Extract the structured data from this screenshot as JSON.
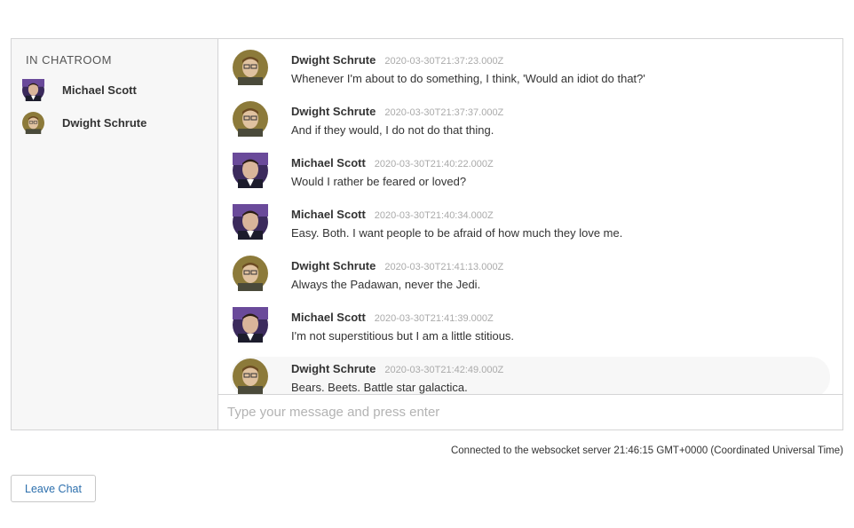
{
  "sidebar": {
    "heading": "IN CHATROOM",
    "members": [
      {
        "name": "Michael Scott",
        "avatar": "michael-avatar"
      },
      {
        "name": "Dwight Schrute",
        "avatar": "dwight-avatar"
      }
    ]
  },
  "messages": [
    {
      "author": "Dwight Schrute",
      "time": "2020-03-30T21:37:23.000Z",
      "text": "Whenever I'm about to do something, I think, 'Would an idiot do that?'"
    },
    {
      "author": "Dwight Schrute",
      "time": "2020-03-30T21:37:37.000Z",
      "text": "And if they would, I do not do that thing."
    },
    {
      "author": "Michael Scott",
      "time": "2020-03-30T21:40:22.000Z",
      "text": "Would I rather be feared or loved?"
    },
    {
      "author": "Michael Scott",
      "time": "2020-03-30T21:40:34.000Z",
      "text": "Easy. Both. I want people to be afraid of how much they love me."
    },
    {
      "author": "Dwight Schrute",
      "time": "2020-03-30T21:41:13.000Z",
      "text": "Always the Padawan, never the Jedi."
    },
    {
      "author": "Michael Scott",
      "time": "2020-03-30T21:41:39.000Z",
      "text": "I'm not superstitious but I am a little stitious."
    },
    {
      "author": "Dwight Schrute",
      "time": "2020-03-30T21:42:49.000Z",
      "text": "Bears. Beets. Battle star galactica."
    }
  ],
  "composer": {
    "placeholder": "Type your message and press enter"
  },
  "status": "Connected to the websocket server 21:46:15 GMT+0000 (Coordinated Universal Time)",
  "leave_button": "Leave Chat",
  "colors": {
    "link": "#2c6fad",
    "border": "#d4d4d5",
    "sidebar_bg": "#f7f7f7",
    "timestamp": "#aaaaaa"
  }
}
